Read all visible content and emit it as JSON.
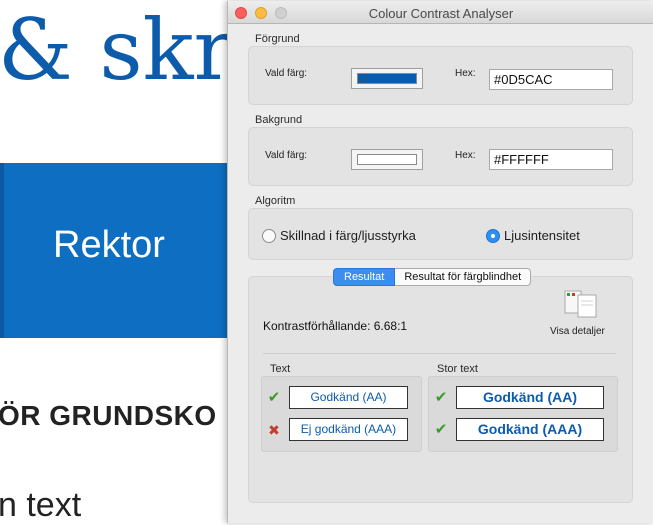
{
  "background_page": {
    "heading": "& skriv",
    "banner_text": "Rektor",
    "subheading": "ÖR GRUNDSKO",
    "body_text": "n text"
  },
  "window": {
    "title": "Colour Contrast Analyser",
    "foreground": {
      "section": "Förgrund",
      "chosen_label": "Vald färg:",
      "hex_label": "Hex:",
      "hex_value": "#0D5CAC",
      "color": "#0D5CAC"
    },
    "background": {
      "section": "Bakgrund",
      "chosen_label": "Vald färg:",
      "hex_label": "Hex:",
      "hex_value": "#FFFFFF",
      "color": "#FFFFFF"
    },
    "algorithm": {
      "section": "Algoritm",
      "option_1": "Skillnad i färg/ljusstyrka",
      "option_2": "Ljusintensitet",
      "selected": "Ljusintensitet"
    },
    "results": {
      "tabs": [
        "Resultat",
        "Resultat för färgblindhet"
      ],
      "active_tab": "Resultat",
      "contrast_ratio": "Kontrastförhållande: 6.68:1",
      "details_label": "Visa detaljer",
      "text_section": "Text",
      "large_text_section": "Stor text",
      "text_aa": "Godkänd (AA)",
      "text_aaa": "Ej godkänd (AAA)",
      "large_aa": "Godkänd (AA)",
      "large_aaa": "Godkänd (AAA)"
    }
  },
  "icons": {
    "pass": "check-icon",
    "fail": "cross-icon",
    "details": "documents-icon"
  }
}
